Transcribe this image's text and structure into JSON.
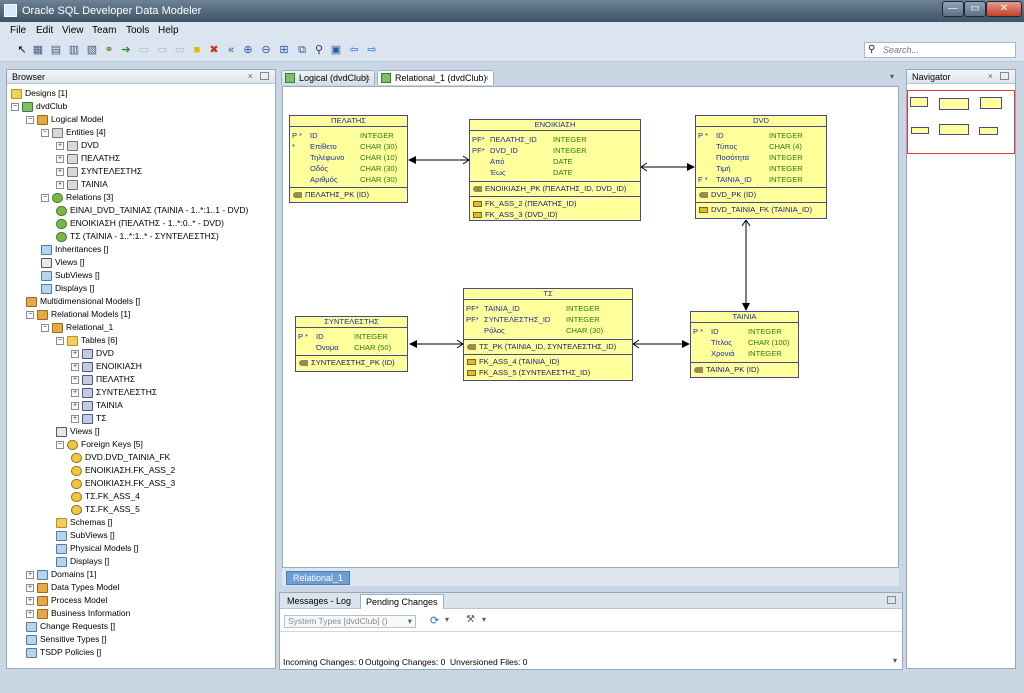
{
  "window": {
    "title": "Oracle SQL Developer Data Modeler",
    "min": "—",
    "max": "▭",
    "close": "✕"
  },
  "menu": [
    "File",
    "Edit",
    "View",
    "Team",
    "Tools",
    "Help"
  ],
  "search": {
    "placeholder": "Search..."
  },
  "browser": {
    "title": "Browser",
    "rows": [
      {
        "label": "Designs [1]",
        "icon": "folder",
        "exp": ""
      },
      {
        "label": "dvdClub",
        "icon": "design",
        "exp": "−"
      },
      {
        "label": "Logical Model",
        "icon": "model",
        "exp": "−"
      },
      {
        "label": "Entities [4]",
        "icon": "entity",
        "exp": "−"
      },
      {
        "label": "DVD",
        "icon": "entity",
        "exp": "+"
      },
      {
        "label": "ΠΕΛΑΤΗΣ",
        "icon": "entity",
        "exp": "+"
      },
      {
        "label": "ΣΥΝΤΕΛΕΣΤΗΣ",
        "icon": "entity",
        "exp": "+"
      },
      {
        "label": "ΤΑΙΝΙΑ",
        "icon": "entity",
        "exp": "+"
      },
      {
        "label": "Relations [3]",
        "icon": "rel",
        "exp": "−"
      },
      {
        "label": "ΕΙΝΑΙ_DVD_ΤΑΙΝΙΑΣ (ΤΑΙΝΙΑ - 1..*:1..1 - DVD)",
        "icon": "rel",
        "exp": ""
      },
      {
        "label": "ΕΝΟΙΚΙΑΣΗ (ΠΕΛΑΤΗΣ - 1..*:0..* - DVD)",
        "icon": "rel",
        "exp": ""
      },
      {
        "label": "ΤΣ (ΤΑΙΝΙΑ - 1..*:1..* - ΣΥΝΤΕΛΕΣΤΗΣ)",
        "icon": "rel",
        "exp": ""
      },
      {
        "label": "Inheritances []",
        "icon": "misc",
        "exp": ""
      },
      {
        "label": "Views []",
        "icon": "view",
        "exp": ""
      },
      {
        "label": "SubViews []",
        "icon": "misc",
        "exp": ""
      },
      {
        "label": "Displays []",
        "icon": "misc",
        "exp": ""
      },
      {
        "label": "Multidimensional Models []",
        "icon": "model",
        "exp": ""
      },
      {
        "label": "Relational Models [1]",
        "icon": "model",
        "exp": "−"
      },
      {
        "label": "Relational_1",
        "icon": "model",
        "exp": "−"
      },
      {
        "label": "Tables [6]",
        "icon": "folder",
        "exp": "−"
      },
      {
        "label": "DVD",
        "icon": "table",
        "exp": "+"
      },
      {
        "label": "ΕΝΟΙΚΙΑΣΗ",
        "icon": "table",
        "exp": "+"
      },
      {
        "label": "ΠΕΛΑΤΗΣ",
        "icon": "table",
        "exp": "+"
      },
      {
        "label": "ΣΥΝΤΕΛΕΣΤΗΣ",
        "icon": "table",
        "exp": "+"
      },
      {
        "label": "ΤΑΙΝΙΑ",
        "icon": "table",
        "exp": "+"
      },
      {
        "label": "ΤΣ",
        "icon": "table",
        "exp": "+"
      },
      {
        "label": "Views []",
        "icon": "view",
        "exp": ""
      },
      {
        "label": "Foreign Keys [5]",
        "icon": "fk",
        "exp": "−"
      },
      {
        "label": "DVD.DVD_ΤΑΙΝΙΑ_FK",
        "icon": "fk",
        "exp": ""
      },
      {
        "label": "ΕΝΟΙΚΙΑΣΗ.FK_ASS_2",
        "icon": "fk",
        "exp": ""
      },
      {
        "label": "ΕΝΟΙΚΙΑΣΗ.FK_ASS_3",
        "icon": "fk",
        "exp": ""
      },
      {
        "label": "ΤΣ.FK_ASS_4",
        "icon": "fk",
        "exp": ""
      },
      {
        "label": "ΤΣ.FK_ASS_5",
        "icon": "fk",
        "exp": ""
      },
      {
        "label": "Schemas []",
        "icon": "folder",
        "exp": ""
      },
      {
        "label": "SubViews []",
        "icon": "misc",
        "exp": ""
      },
      {
        "label": "Physical Models []",
        "icon": "misc",
        "exp": ""
      },
      {
        "label": "Displays []",
        "icon": "misc",
        "exp": ""
      },
      {
        "label": "Domains [1]",
        "icon": "misc",
        "exp": "+"
      },
      {
        "label": "Data Types Model",
        "icon": "model",
        "exp": "+"
      },
      {
        "label": "Process Model",
        "icon": "model",
        "exp": "+"
      },
      {
        "label": "Business Information",
        "icon": "model",
        "exp": "+"
      },
      {
        "label": "Change Requests []",
        "icon": "misc",
        "exp": ""
      },
      {
        "label": "Sensitive Types []",
        "icon": "misc",
        "exp": ""
      },
      {
        "label": "TSDP Policies []",
        "icon": "misc",
        "exp": ""
      }
    ]
  },
  "editor_tabs": [
    "Logical (dvdClub)",
    "Relational_1 (dvdClub)"
  ],
  "tables": {
    "pelatis": {
      "name": "ΠΕΛΑΤΗΣ",
      "columns": [
        {
          "flags": "P  *",
          "name": "ID",
          "type": "INTEGER"
        },
        {
          "flags": "   *",
          "name": "Επίθετο",
          "type": "CHAR (30)"
        },
        {
          "flags": "",
          "name": "Τηλέφωνο",
          "type": "CHAR (10)"
        },
        {
          "flags": "",
          "name": "Οδός",
          "type": "CHAR (30)"
        },
        {
          "flags": "",
          "name": "Αριθμός",
          "type": "CHAR (30)"
        }
      ],
      "pk": "ΠΕΛΑΤΗΣ_PK (ID)"
    },
    "enoikiasi": {
      "name": "ΕΝΟΙΚΙΑΣΗ",
      "columns": [
        {
          "flags": "PF*",
          "name": "ΠΕΛΑΤΗΣ_ID",
          "type": "INTEGER"
        },
        {
          "flags": "PF*",
          "name": "DVD_ID",
          "type": "INTEGER"
        },
        {
          "flags": "",
          "name": "Από",
          "type": "DATE"
        },
        {
          "flags": "",
          "name": "Έως",
          "type": "DATE"
        }
      ],
      "pk": "ΕΝΟΙΚΙΑΣΗ_PK (ΠΕΛΑΤΗΣ_ID, DVD_ID)",
      "fks": [
        "FK_ASS_2 (ΠΕΛΑΤΗΣ_ID)",
        "FK_ASS_3 (DVD_ID)"
      ]
    },
    "dvd": {
      "name": "DVD",
      "columns": [
        {
          "flags": "P  *",
          "name": "ID",
          "type": "INTEGER"
        },
        {
          "flags": "",
          "name": "Τύπος",
          "type": "CHAR (4)"
        },
        {
          "flags": "",
          "name": "Ποσότητα",
          "type": "INTEGER"
        },
        {
          "flags": "",
          "name": "Τιμή",
          "type": "INTEGER"
        },
        {
          "flags": "F  *",
          "name": "ΤΑΙΝΙΑ_ID",
          "type": "INTEGER"
        }
      ],
      "pk": "DVD_PK (ID)",
      "fks": [
        "DVD_ΤΑΙΝΙΑ_FK (ΤΑΙΝΙΑ_ID)"
      ]
    },
    "syntelestis": {
      "name": "ΣΥΝΤΕΛΕΣΤΗΣ",
      "columns": [
        {
          "flags": "P  *",
          "name": "ID",
          "type": "INTEGER"
        },
        {
          "flags": "",
          "name": "Όνομα",
          "type": "CHAR (50)"
        }
      ],
      "pk": "ΣΥΝΤΕΛΕΣΤΗΣ_PK (ID)"
    },
    "ts": {
      "name": "ΤΣ",
      "columns": [
        {
          "flags": "PF*",
          "name": "ΤΑΙΝΙΑ_ID",
          "type": "INTEGER"
        },
        {
          "flags": "PF*",
          "name": "ΣΥΝΤΕΛΕΣΤΗΣ_ID",
          "type": "INTEGER"
        },
        {
          "flags": "",
          "name": "Ρόλος",
          "type": "CHAR (30)"
        }
      ],
      "pk": "ΤΣ_PK (ΤΑΙΝΙΑ_ID, ΣΥΝΤΕΛΕΣΤΗΣ_ID)",
      "fks": [
        "FK_ASS_4 (ΤΑΙΝΙΑ_ID)",
        "FK_ASS_5 (ΣΥΝΤΕΛΕΣΤΗΣ_ID)"
      ]
    },
    "tainia": {
      "name": "ΤΑΙΝΙΑ",
      "columns": [
        {
          "flags": "P  *",
          "name": "ID",
          "type": "INTEGER"
        },
        {
          "flags": "",
          "name": "Τίτλος",
          "type": "CHAR (100)"
        },
        {
          "flags": "",
          "name": "Χρονιά",
          "type": "INTEGER"
        }
      ],
      "pk": "ΤΑΙΝΙΑ_PK (ID)"
    }
  },
  "canvas_tab": "Relational_1",
  "bottom": {
    "tabs": [
      "Messages - Log",
      "Pending Changes"
    ],
    "select_value": "System Types [dvdClub] ()",
    "incoming": "Incoming Changes: 0",
    "outgoing": "Outgoing Changes: 0",
    "unversioned": "Unversioned Files: 0"
  },
  "navigator": {
    "title": "Navigator"
  },
  "colors": {
    "entity_fill": "#ffff9c",
    "entity_border": "#4a4a8a",
    "name_text": "#1a2f9a",
    "type_text": "#2a7a1a"
  }
}
